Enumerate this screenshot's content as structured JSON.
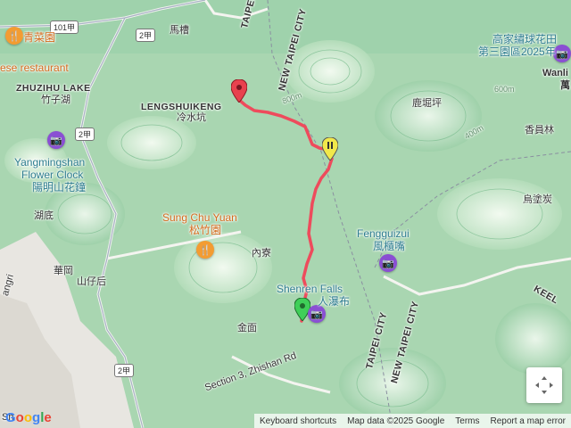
{
  "labels": {
    "restaurant_partial_zh": "青菜園",
    "restaurant_partial_en": "ese restaurant",
    "zhuzihu_en": "ZHUZIHU LAKE",
    "zhuzihu_zh": "竹子湖",
    "mayao": "馬槽",
    "lengshuikeng_en": "LENGSHUIKENG",
    "lengshuikeng_zh": "冷水坑",
    "taipei_city_top": "TAIPEI CITY",
    "new_taipei_city_top": "NEW TAIPEI CITY",
    "gaojia_zh": "高家繡球花田",
    "gaojia_zh2": "第三園區2025年",
    "wanli_en": "Wanli",
    "wanli_zh": "萬",
    "lujueping": "鹿堀坪",
    "xiangyuanlin": "香員林",
    "wutukeng": "烏塗炭",
    "yms_clock_en1": "Yangmingshan",
    "yms_clock_en2": "Flower Clock",
    "yms_clock_zh": "陽明山花鐘",
    "sungchu_en": "Sung Chu Yuan",
    "sungchu_zh": "松竹園",
    "hudi": "湖底",
    "neiliao": "內寮",
    "fengguizui_en": "Fengguizui",
    "fengguizui_zh": "風櫃嘴",
    "huagang": "華岡",
    "shanzaihou": "山仔后",
    "shenren_en": "Shenren Falls",
    "shenren_zh": "人瀑布",
    "jinmian": "金面",
    "taipei_city_bottom": "TAIPEI CITY",
    "new_taipei_city_bottom": "NEW TAIPEI CITY",
    "keelung_partial": "KEEL",
    "section3": "Section 3, Zhishan Rd",
    "left_edge1": "angri",
    "left_edge2": "Sh"
  },
  "road_shields": {
    "r101": "101甲",
    "r2_top": "2甲",
    "r2_mid": "2甲",
    "r2_bottom": "2甲"
  },
  "contours": [
    "800m",
    "600m",
    "400m",
    "800m",
    "400m",
    "600m",
    "400m"
  ],
  "footer": {
    "google": "Google",
    "keyboard": "Keyboard shortcuts",
    "map_data": "Map data ©2025 Google",
    "terms": "Terms",
    "report": "Report a map error"
  },
  "colors": {
    "route": "#ee4b5c",
    "start_marker": "#3fcf58",
    "end_marker": "#e8414e",
    "waypoint_marker": "#f1e84a",
    "terrain_light": "#d6ecd8",
    "terrain_mid": "#9fd1aa",
    "terrain_dark": "#6fb88a",
    "road": "#7f8fa8"
  }
}
